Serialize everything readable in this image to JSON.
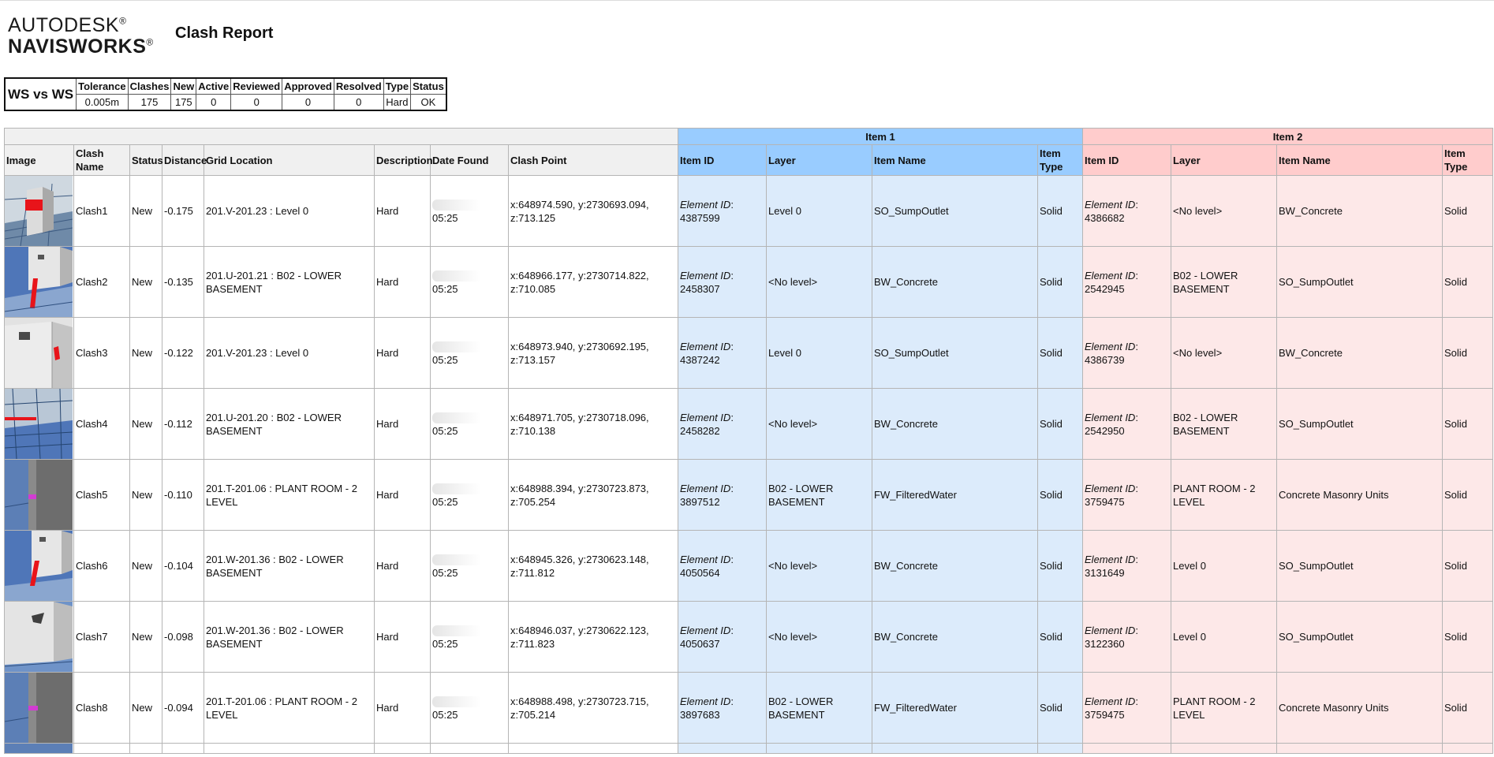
{
  "logo": {
    "line1": "AUTODESK",
    "line2": "NAVISWORKS"
  },
  "report_title": "Clash Report",
  "summary": {
    "name": "WS vs WS",
    "headers": [
      "Tolerance",
      "Clashes",
      "New",
      "Active",
      "Reviewed",
      "Approved",
      "Resolved",
      "Type",
      "Status"
    ],
    "values": [
      "0.005m",
      "175",
      "175",
      "0",
      "0",
      "0",
      "0",
      "Hard",
      "OK"
    ]
  },
  "table": {
    "group_item1": "Item 1",
    "group_item2": "Item 2",
    "headers": {
      "image": "Image",
      "clash_name": "Clash Name",
      "status": "Status",
      "distance": "Distance",
      "grid_location": "Grid Location",
      "description": "Description",
      "date_found": "Date Found",
      "clash_point": "Clash Point",
      "item_id": "Item ID",
      "layer": "Layer",
      "item_name": "Item Name",
      "item_type": "Item Type"
    },
    "element_id_label": "Element ID",
    "rows": [
      {
        "name": "Clash1",
        "status": "New",
        "distance": "-0.175",
        "grid": "201.V-201.23 : Level 0",
        "description": "Hard",
        "time": "05:25",
        "point": "x:648974.590, y:2730693.094, z:713.125",
        "i1_id": "4387599",
        "i1_layer": "Level 0",
        "i1_name": "SO_SumpOutlet",
        "i1_type": "Solid",
        "i2_id": "4386682",
        "i2_layer": "<No level>",
        "i2_name": "BW_Concrete",
        "i2_type": "Solid"
      },
      {
        "name": "Clash2",
        "status": "New",
        "distance": "-0.135",
        "grid": "201.U-201.21 : B02 - LOWER BASEMENT",
        "description": "Hard",
        "time": "05:25",
        "point": "x:648966.177, y:2730714.822, z:710.085",
        "i1_id": "2458307",
        "i1_layer": "<No level>",
        "i1_name": "BW_Concrete",
        "i1_type": "Solid",
        "i2_id": "2542945",
        "i2_layer": "B02 - LOWER BASEMENT",
        "i2_name": "SO_SumpOutlet",
        "i2_type": "Solid"
      },
      {
        "name": "Clash3",
        "status": "New",
        "distance": "-0.122",
        "grid": "201.V-201.23 : Level 0",
        "description": "Hard",
        "time": "05:25",
        "point": "x:648973.940, y:2730692.195, z:713.157",
        "i1_id": "4387242",
        "i1_layer": "Level 0",
        "i1_name": "SO_SumpOutlet",
        "i1_type": "Solid",
        "i2_id": "4386739",
        "i2_layer": "<No level>",
        "i2_name": "BW_Concrete",
        "i2_type": "Solid"
      },
      {
        "name": "Clash4",
        "status": "New",
        "distance": "-0.112",
        "grid": "201.U-201.20 : B02 - LOWER BASEMENT",
        "description": "Hard",
        "time": "05:25",
        "point": "x:648971.705, y:2730718.096, z:710.138",
        "i1_id": "2458282",
        "i1_layer": "<No level>",
        "i1_name": "BW_Concrete",
        "i1_type": "Solid",
        "i2_id": "2542950",
        "i2_layer": "B02 - LOWER BASEMENT",
        "i2_name": "SO_SumpOutlet",
        "i2_type": "Solid"
      },
      {
        "name": "Clash5",
        "status": "New",
        "distance": "-0.110",
        "grid": "201.T-201.06 : PLANT ROOM - 2 LEVEL",
        "description": "Hard",
        "time": "05:25",
        "point": "x:648988.394, y:2730723.873, z:705.254",
        "i1_id": "3897512",
        "i1_layer": "B02 - LOWER BASEMENT",
        "i1_name": "FW_FilteredWater",
        "i1_type": "Solid",
        "i2_id": "3759475",
        "i2_layer": "PLANT ROOM - 2 LEVEL",
        "i2_name": "Concrete Masonry Units",
        "i2_type": "Solid"
      },
      {
        "name": "Clash6",
        "status": "New",
        "distance": "-0.104",
        "grid": "201.W-201.36 : B02 - LOWER BASEMENT",
        "description": "Hard",
        "time": "05:25",
        "point": "x:648945.326, y:2730623.148, z:711.812",
        "i1_id": "4050564",
        "i1_layer": "<No level>",
        "i1_name": "BW_Concrete",
        "i1_type": "Solid",
        "i2_id": "3131649",
        "i2_layer": "Level 0",
        "i2_name": "SO_SumpOutlet",
        "i2_type": "Solid"
      },
      {
        "name": "Clash7",
        "status": "New",
        "distance": "-0.098",
        "grid": "201.W-201.36 : B02 - LOWER BASEMENT",
        "description": "Hard",
        "time": "05:25",
        "point": "x:648946.037, y:2730622.123, z:711.823",
        "i1_id": "4050637",
        "i1_layer": "<No level>",
        "i1_name": "BW_Concrete",
        "i1_type": "Solid",
        "i2_id": "3122360",
        "i2_layer": "Level 0",
        "i2_name": "SO_SumpOutlet",
        "i2_type": "Solid"
      },
      {
        "name": "Clash8",
        "status": "New",
        "distance": "-0.094",
        "grid": "201.T-201.06 : PLANT ROOM - 2 LEVEL",
        "description": "Hard",
        "time": "05:25",
        "point": "x:648988.498, y:2730723.715, z:705.214",
        "i1_id": "3897683",
        "i1_layer": "B02 - LOWER BASEMENT",
        "i1_name": "FW_FilteredWater",
        "i1_type": "Solid",
        "i2_id": "3759475",
        "i2_layer": "PLANT ROOM - 2 LEVEL",
        "i2_name": "Concrete Masonry Units",
        "i2_type": "Solid"
      }
    ]
  },
  "colors": {
    "item1_header": "#99ccff",
    "item1_cell": "#dcebfb",
    "item2_header": "#ffcccc",
    "item2_cell": "#fde8e8",
    "clash_marker": "#e8141a"
  }
}
